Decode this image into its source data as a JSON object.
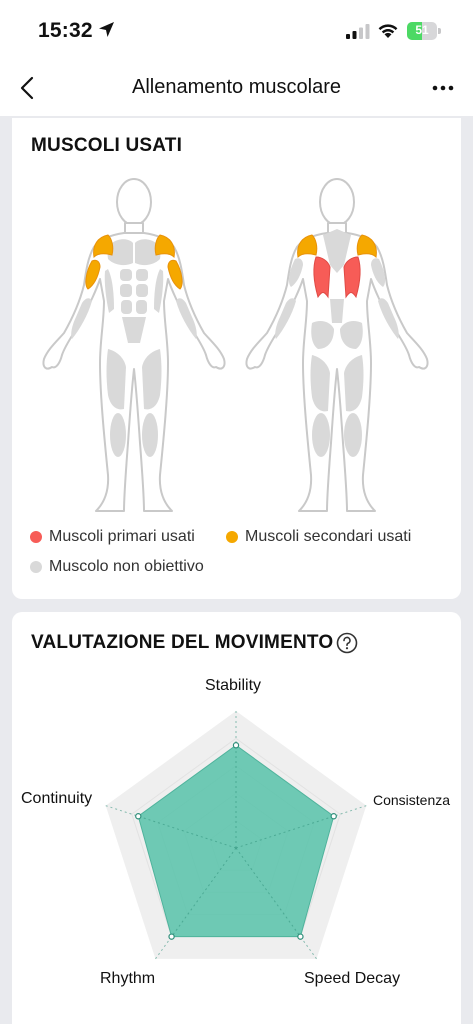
{
  "status_bar": {
    "time": "15:32",
    "battery_level": "51",
    "battery_fraction": 0.51
  },
  "nav": {
    "title": "Allenamento muscolare",
    "back_icon": "chevron-left-icon",
    "more_icon": "ellipsis-icon"
  },
  "muscles_card": {
    "title": "MUSCOLI USATI",
    "legend": [
      {
        "label": "Muscoli primari usati",
        "color": "#f75c57"
      },
      {
        "label": "Muscoli secondari usati",
        "color": "#f5a800"
      },
      {
        "label": "Muscolo non obiettivo",
        "color": "#d9d9d9"
      }
    ],
    "front_secondary": [
      "deltoids",
      "biceps"
    ],
    "back_primary": [
      "latissimus dorsi"
    ],
    "back_secondary": [
      "rear deltoids"
    ]
  },
  "movement_card": {
    "title": "VALUTAZIONE DEL MOVIMENTO",
    "help_icon": "question-circle-icon",
    "chart_data": {
      "type": "radar",
      "axes": [
        "Stability",
        "Consistenza",
        "Speed Decay",
        "Rhythm",
        "Continuity"
      ],
      "values": [
        0.75,
        0.75,
        0.8,
        0.8,
        0.75
      ],
      "max": 1,
      "fill_color": "#5fc4ad",
      "grid_color": "#efefef"
    }
  }
}
